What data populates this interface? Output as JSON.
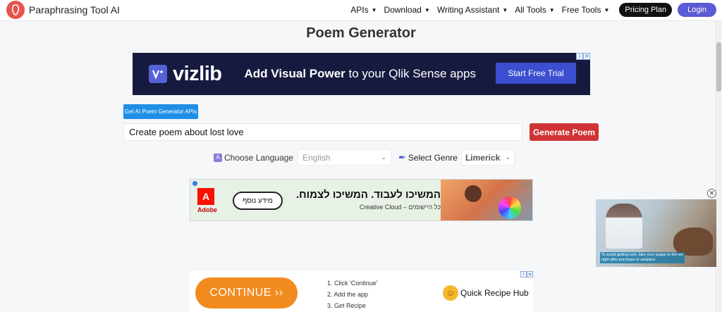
{
  "app": {
    "name": "Paraphrasing Tool AI"
  },
  "nav": {
    "items": [
      {
        "label": "APIs"
      },
      {
        "label": "Download"
      },
      {
        "label": "Writing Assistant"
      },
      {
        "label": "All Tools"
      },
      {
        "label": "Free Tools"
      }
    ],
    "caret": "▼",
    "pricing_label": "Pricing Plan",
    "login_label": "Login"
  },
  "page": {
    "title": "Poem Generator"
  },
  "ad_top": {
    "brand": "vizlib",
    "tagline_bold": "Add Visual Power",
    "tagline_rest": " to your Qlik Sense apps",
    "cta": "Start Free Trial"
  },
  "api_button": "Get AI Poem Generator APIs",
  "prompt": {
    "value": "Create poem about  lost love"
  },
  "generate_label": "Generate Poem",
  "language": {
    "label": "Choose Language",
    "selected": "English"
  },
  "genre": {
    "label": "Select Genre",
    "selected": "Limerick"
  },
  "ad_middle": {
    "brand": "Adobe",
    "pill": "מידע נוסף",
    "headline": "המשיכו לעבוד. המשיכו לצמוח.",
    "subline": "כל היישומים – Creative Cloud"
  },
  "video_ad": {
    "caption": "To avoid getting sick, take your puppy to the vet right after purchase or adoption"
  },
  "ad_bottom": {
    "continue_label": "CONTINUE ››",
    "steps": [
      "1. Click 'Continue'",
      "2. Add the app",
      "3. Get Recipe"
    ],
    "brand": "Quick Recipe Hub"
  },
  "colors": {
    "accent": "#5b5bd6",
    "generate": "#d03335",
    "api_button": "#1f8fe6",
    "ad_top_bg": "#171a3f"
  },
  "icons": [
    "logo-icon",
    "caret-down-icon",
    "language-icon",
    "quill-icon",
    "chevron-down-icon",
    "close-icon",
    "adchoices-icon"
  ]
}
